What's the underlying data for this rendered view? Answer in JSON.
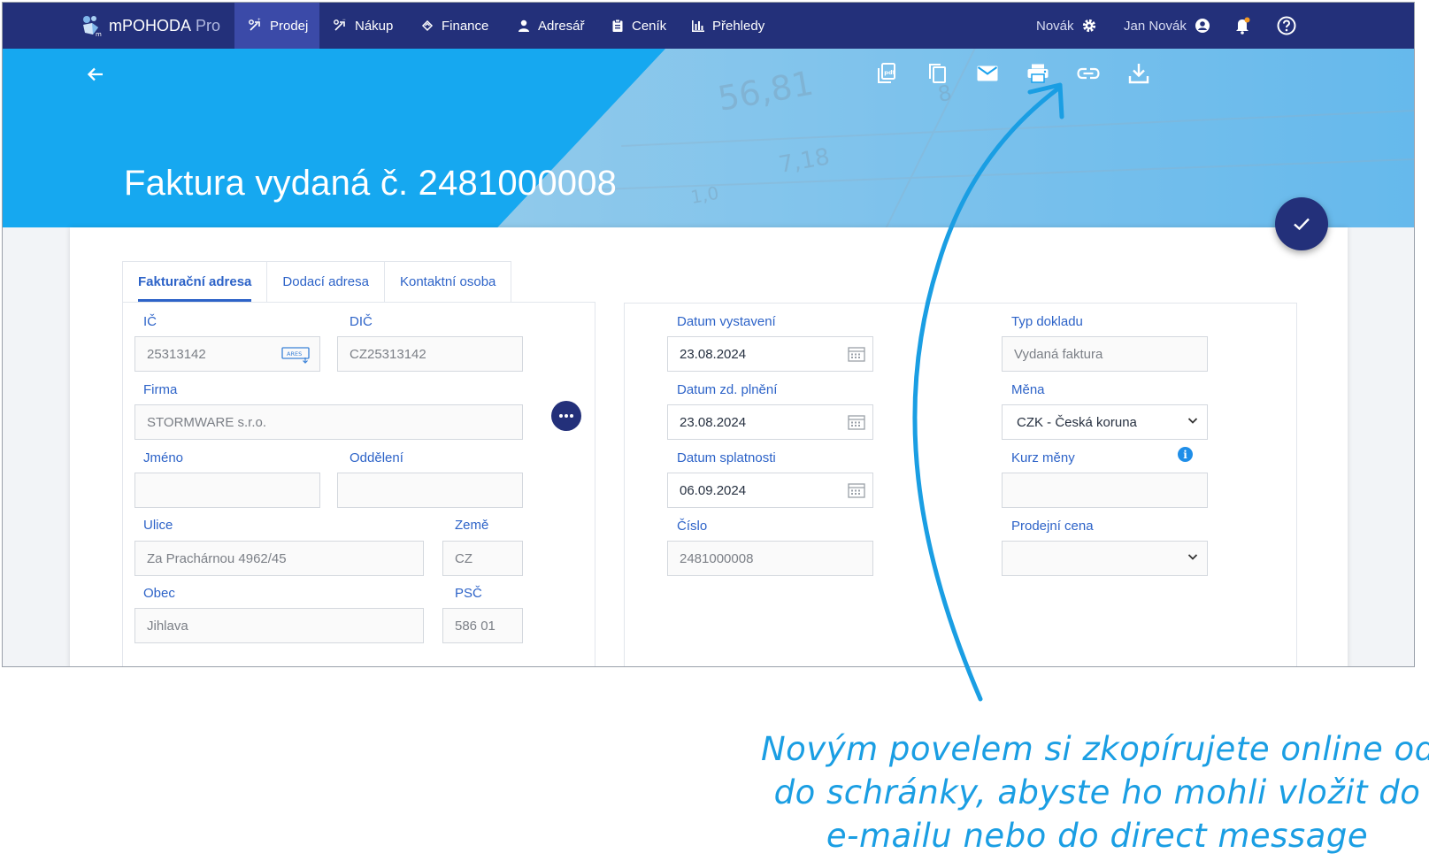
{
  "navbar": {
    "brand_name": "mPOHODA",
    "brand_suffix": "Pro",
    "items": [
      {
        "label": "Prodej",
        "icon": "sales-icon",
        "active": true
      },
      {
        "label": "Nákup",
        "icon": "purchase-icon",
        "active": false
      },
      {
        "label": "Finance",
        "icon": "finance-icon",
        "active": false
      },
      {
        "label": "Adresář",
        "icon": "person-icon",
        "active": false
      },
      {
        "label": "Ceník",
        "icon": "clipboard-icon",
        "active": false
      },
      {
        "label": "Přehledy",
        "icon": "bar-chart-icon",
        "active": false
      }
    ],
    "company": "Novák",
    "user": "Jan Novák"
  },
  "header": {
    "title": "Faktura vydaná č. 2481000008",
    "actions": [
      "pdf-icon",
      "copy-icon",
      "email-icon",
      "print-icon",
      "link-icon",
      "download-icon"
    ]
  },
  "tabs": [
    {
      "label": "Fakturační adresa",
      "active": true
    },
    {
      "label": "Dodací adresa",
      "active": false
    },
    {
      "label": "Kontaktní osoba",
      "active": false
    }
  ],
  "billing": {
    "ic_label": "IČ",
    "ic_value": "25313142",
    "ares_label": "ARES",
    "dic_label": "DIČ",
    "dic_value": "CZ25313142",
    "firma_label": "Firma",
    "firma_value": "STORMWARE s.r.o.",
    "jmeno_label": "Jméno",
    "jmeno_value": "",
    "oddeleni_label": "Oddělení",
    "oddeleni_value": "",
    "ulice_label": "Ulice",
    "ulice_value": "Za Prachárnou 4962/45",
    "zeme_label": "Země",
    "zeme_value": "CZ",
    "obec_label": "Obec",
    "obec_value": "Jihlava",
    "psc_label": "PSČ",
    "psc_value": "586 01"
  },
  "document": {
    "datum_vystaveni_label": "Datum vystavení",
    "datum_vystaveni_value": "23.08.2024",
    "datum_zd_label": "Datum zd. plnění",
    "datum_zd_value": "23.08.2024",
    "datum_splatnosti_label": "Datum splatnosti",
    "datum_splatnosti_value": "06.09.2024",
    "cislo_label": "Číslo",
    "cislo_value": "2481000008",
    "typ_label": "Typ dokladu",
    "typ_value": "Vydaná faktura",
    "mena_label": "Měna",
    "mena_value": "CZK - Česká koruna",
    "kurz_label": "Kurz měny",
    "kurz_value": "",
    "prodejni_cena_label": "Prodejní cena",
    "prodejni_cena_value": ""
  },
  "annotation": {
    "line1": "Novým povelem si zkopírujete online odkaz",
    "line2": "do schránky, abyste ho mohli vložit do",
    "line3": "e-mailu nebo do direct message"
  },
  "colors": {
    "navbar": "#23307a",
    "banner": "#16a8f0",
    "accent": "#2d63c8",
    "annotation": "#1a9ee3"
  }
}
